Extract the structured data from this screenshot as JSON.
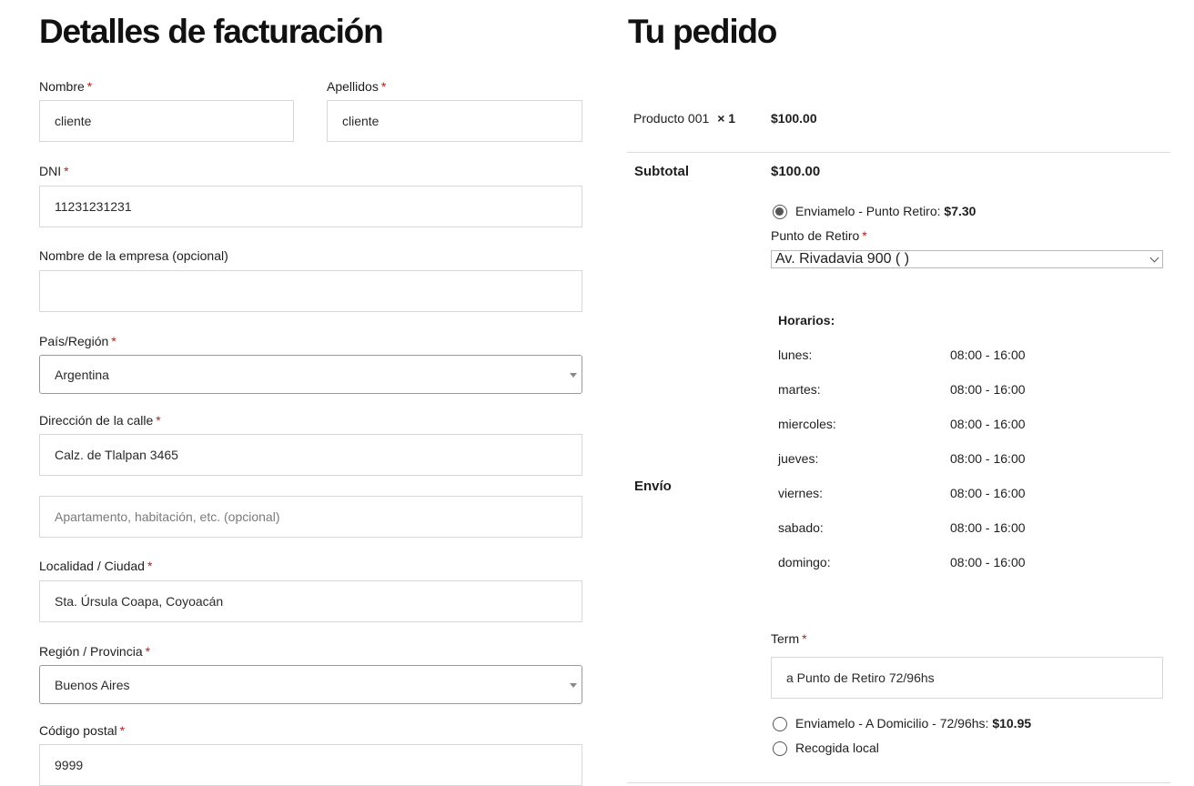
{
  "billing": {
    "title": "Detalles de facturación",
    "first_name": {
      "label": "Nombre",
      "value": "cliente"
    },
    "last_name": {
      "label": "Apellidos",
      "value": "cliente"
    },
    "dni": {
      "label": "DNI",
      "value": "11231231231"
    },
    "company": {
      "label": "Nombre de la empresa (opcional)",
      "value": ""
    },
    "country": {
      "label": "País/Región",
      "value": "Argentina"
    },
    "street": {
      "label": "Dirección de la calle",
      "value": "Calz. de Tlalpan 3465",
      "apt_placeholder": "Apartamento, habitación, etc. (opcional)"
    },
    "city": {
      "label": "Localidad / Ciudad",
      "value": "Sta. Úrsula Coapa, Coyoacán"
    },
    "state": {
      "label": "Región / Provincia",
      "value": "Buenos Aires"
    },
    "postcode": {
      "label": "Código postal",
      "value": "9999"
    },
    "required_mark": "*"
  },
  "order": {
    "title": "Tu pedido",
    "product": {
      "name": "Producto 001",
      "qty": "× 1",
      "price": "$100.00"
    },
    "subtotal": {
      "label": "Subtotal",
      "value": "$100.00"
    },
    "shipping": {
      "label": "Envío",
      "options": [
        {
          "label": "Enviamelo - Punto Retiro:",
          "price": "$7.30",
          "selected": true
        },
        {
          "label": "Enviamelo - A Domicilio - 72/96hs:",
          "price": "$10.95",
          "selected": false
        },
        {
          "label": "Recogida local",
          "price": "",
          "selected": false
        }
      ],
      "pickup_label": "Punto de Retiro",
      "pickup_value": "Av. Rivadavia 900 ( )",
      "hours_title": "Horarios:",
      "hours": [
        {
          "day": "lunes:",
          "time": "08:00 - 16:00"
        },
        {
          "day": "martes:",
          "time": "08:00 - 16:00"
        },
        {
          "day": "miercoles:",
          "time": "08:00 - 16:00"
        },
        {
          "day": "jueves:",
          "time": "08:00 - 16:00"
        },
        {
          "day": "viernes:",
          "time": "08:00 - 16:00"
        },
        {
          "day": "sabado:",
          "time": "08:00 - 16:00"
        },
        {
          "day": "domingo:",
          "time": "08:00 - 16:00"
        }
      ],
      "term_label": "Term",
      "term_value": "a Punto de Retiro 72/96hs"
    }
  },
  "colors": {
    "required": "#b22222",
    "border": "#d8d8d8",
    "text": "#1e1e1e"
  }
}
